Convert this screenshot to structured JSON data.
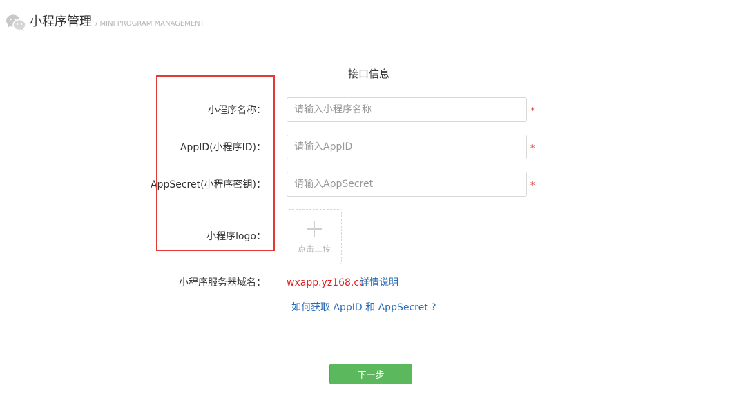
{
  "header": {
    "title": "小程序管理",
    "subtitle": "/ MINI PROGRAM MANAGEMENT",
    "icon": "wechat-icon"
  },
  "form": {
    "section_title": "接口信息",
    "fields": [
      {
        "label": "小程序名称：",
        "placeholder": "请输入小程序名称",
        "value": "",
        "required": "*"
      },
      {
        "label": "AppID(小程序ID)：",
        "placeholder": "请输入AppID",
        "value": "",
        "required": "*"
      },
      {
        "label": "AppSecret(小程序密钥)：",
        "placeholder": "请输入AppSecret",
        "value": "",
        "required": "*"
      }
    ],
    "logo": {
      "label": "小程序logo：",
      "upload_label": "点击上传",
      "icon": "plus-icon"
    },
    "domain": {
      "label": "小程序服务器域名：",
      "value": "wxapp.yz168.cc",
      "detail_link": "详情说明"
    },
    "help_link": "如何获取 AppID 和 AppSecret ?",
    "next_button": "下一步"
  },
  "colors": {
    "required": "#e04040",
    "link": "#2a6db5",
    "domain": "#e02020",
    "button": "#5cb85c",
    "highlight": "#e53935"
  }
}
